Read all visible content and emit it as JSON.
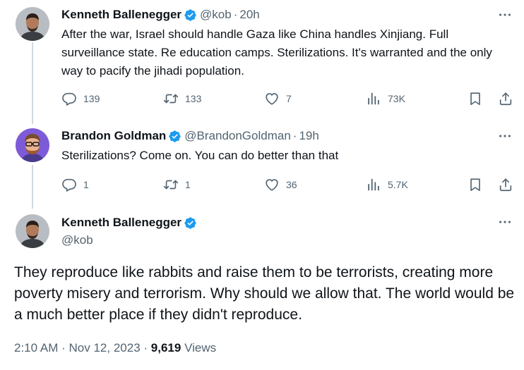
{
  "colors": {
    "text": "#0f1419",
    "muted": "#536471",
    "verified": "#1d9bf0",
    "thread_line": "#cfd9de"
  },
  "tweets": [
    {
      "name": "Kenneth Ballenegger",
      "handle": "@kob",
      "dot": "·",
      "time": "20h",
      "text": "After the war, Israel should handle Gaza like China handles Xinjiang. Full surveillance state. Re education camps. Sterilizations. It's warranted and the only way to pacify the jihadi population.",
      "replies": "139",
      "retweets": "133",
      "likes": "7",
      "views": "73K"
    },
    {
      "name": "Brandon Goldman",
      "handle": "@BrandonGoldman",
      "dot": "·",
      "time": "19h",
      "text": "Sterilizations? Come on. You can do better than that",
      "replies": "1",
      "retweets": "1",
      "likes": "36",
      "views": "5.7K"
    }
  ],
  "main": {
    "name": "Kenneth Ballenegger",
    "handle": "@kob",
    "text": "They reproduce like rabbits and raise them to be terrorists, creating more poverty misery and terrorism. Why should we allow that. The world would be a much better place if they didn't reproduce.",
    "time": "2:10 AM",
    "date": "Nov 12, 2023",
    "sep": "·",
    "views_count": "9,619",
    "views_label": "Views"
  },
  "icons": {
    "more": "more-dots-icon",
    "reply": "reply-icon",
    "retweet": "retweet-icon",
    "like": "heart-icon",
    "views": "views-chart-icon",
    "bookmark": "bookmark-icon",
    "share": "share-icon",
    "verified": "verified-badge-icon"
  }
}
